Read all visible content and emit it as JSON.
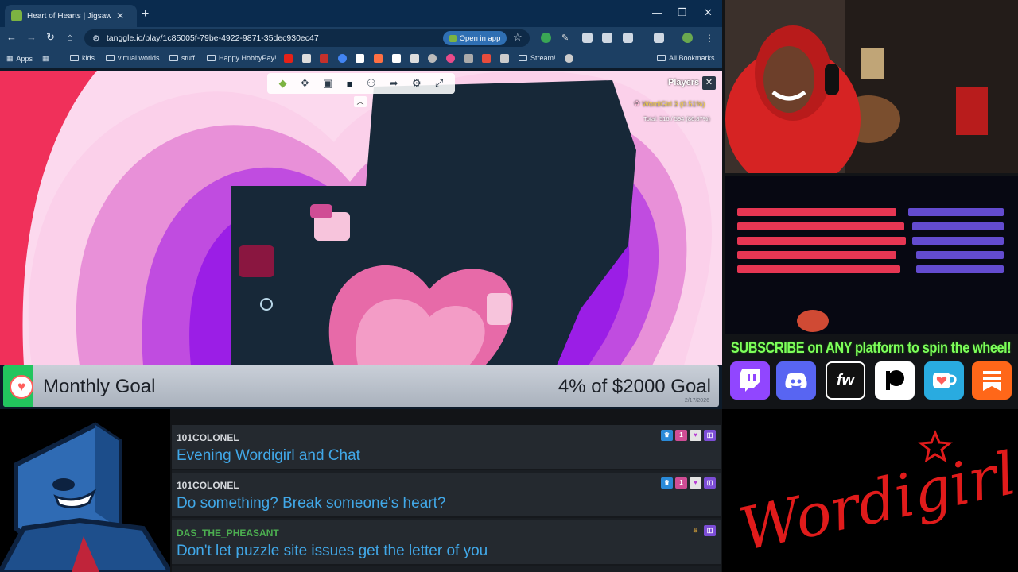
{
  "browser": {
    "tab_title": "Heart of Hearts | Jigsaw Puz",
    "url": "tanggle.io/play/1c85005f-79be-4922-9871-35dec930ec47",
    "open_in_app": "Open in app",
    "bookmarks": [
      "Apps",
      "kids",
      "virtual worlds",
      "stuff",
      "Happy HobbyPay!",
      "Stream!"
    ],
    "all_bookmarks": "All Bookmarks"
  },
  "game": {
    "players_label": "Players",
    "player_entry": "WordiGirl  3 (0.51%)",
    "total": "Total: 516 / 594 (86.87%)",
    "colors": {
      "dark_board": "#172838",
      "purple": "#9b1ee6",
      "pink": "#f08fd1",
      "red": "#f0305a",
      "rose": "#e76aa8"
    }
  },
  "goal": {
    "title": "Monthly Goal",
    "progress": "4% of $2000 Goal",
    "percent": 4,
    "date": "2/17/2026",
    "color": "#22c55e"
  },
  "subscribe": {
    "text": "SUBSCRIBE on ANY platform to spin the wheel!",
    "platforms": [
      {
        "name": "twitch-icon",
        "label": "",
        "color": "#9146ff"
      },
      {
        "name": "discord-icon",
        "label": "",
        "color": "#5865f2"
      },
      {
        "name": "fourthwall-icon",
        "label": "fw",
        "color": "#111111"
      },
      {
        "name": "patreon-icon",
        "label": "",
        "color": "#ffffff"
      },
      {
        "name": "kofi-icon",
        "label": "",
        "color": "#29abe0"
      },
      {
        "name": "substack-icon",
        "label": "",
        "color": "#ff6719"
      }
    ]
  },
  "chat": {
    "messages": [
      {
        "user": "101COLONEL",
        "user_color": "#d6d9dd",
        "text": "Evening Wordigirl and Chat"
      },
      {
        "user": "101COLONEL",
        "user_color": "#d6d9dd",
        "text": "Do something? Break someone's heart?"
      },
      {
        "user": "DAS_THE_PHEASANT",
        "user_color": "#4caf50",
        "text": "Don't let puzzle site issues get the letter of you"
      }
    ]
  },
  "logo": {
    "text": "Wordigirl",
    "color": "#e01b1b"
  }
}
